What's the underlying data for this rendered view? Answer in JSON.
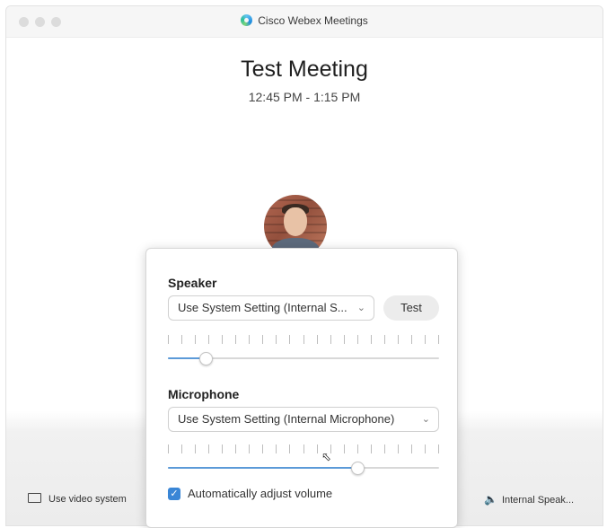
{
  "window": {
    "app_title": "Cisco Webex Meetings"
  },
  "meeting": {
    "title": "Test Meeting",
    "time": "12:45 PM - 1:15 PM"
  },
  "popover": {
    "speaker": {
      "label": "Speaker",
      "selected": "Use System Setting (Internal S...",
      "test_label": "Test",
      "volume": 0.14
    },
    "microphone": {
      "label": "Microphone",
      "selected": "Use System Setting (Internal Microphone)",
      "volume": 0.7
    },
    "auto_adjust": {
      "label": "Automatically adjust volume",
      "checked": true
    }
  },
  "bottom": {
    "video_system_label": "Use video system",
    "audio_label": "Internal Speak..."
  },
  "colors": {
    "accent": "#3a86d6",
    "slider_fill": "#5b9ad8"
  }
}
